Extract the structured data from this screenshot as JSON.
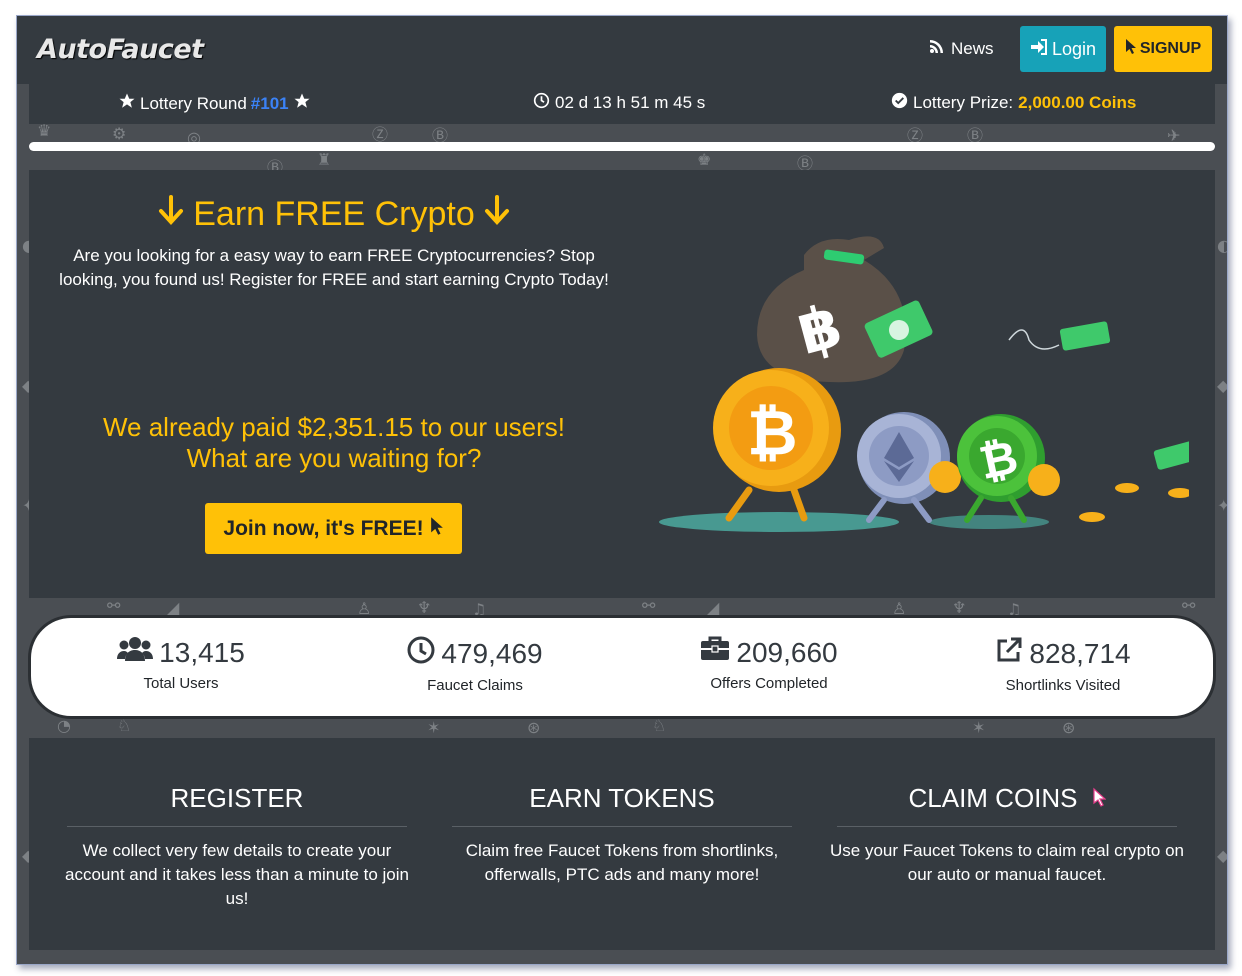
{
  "navbar": {
    "brand": "AutoFaucet",
    "news_label": "News",
    "login_label": "Login",
    "signup_label": "SIGNUP"
  },
  "lottery": {
    "round_label": "Lottery Round",
    "round_number": "#101",
    "countdown": "02 d 13 h 51 m 45 s",
    "prize_label": "Lottery Prize:",
    "prize_amount": "2,000.00 Coins"
  },
  "hero": {
    "title": "Earn FREE Crypto",
    "description": "Are you looking for a easy way to earn FREE Cryptocurrencies? Stop looking, you found us! Register for FREE and start earning Crypto Today!",
    "paid_line1": "We already paid $2,351.15 to our users!",
    "paid_line2": "What are you waiting for?",
    "join_label": "Join now, it's FREE!"
  },
  "stats": [
    {
      "icon": "users-icon",
      "value": "13,415",
      "label": "Total Users"
    },
    {
      "icon": "clock-icon",
      "value": "479,469",
      "label": "Faucet Claims"
    },
    {
      "icon": "briefcase-icon",
      "value": "209,660",
      "label": "Offers Completed"
    },
    {
      "icon": "external-link-icon",
      "value": "828,714",
      "label": "Shortlinks Visited"
    }
  ],
  "steps": [
    {
      "title": "REGISTER",
      "description": "We collect very few details to create your account and it takes less than a minute to join us!"
    },
    {
      "title": "EARN TOKENS",
      "description": "Claim free Faucet Tokens from shortlinks, offerwalls, PTC ads and many more!"
    },
    {
      "title": "CLAIM COINS",
      "description": "Use your Faucet Tokens to claim real crypto on our auto or manual faucet."
    }
  ],
  "colors": {
    "accent_yellow": "#ffc107",
    "login_teal": "#17a2b8",
    "panel_dark": "#343a40",
    "round_blue": "#3b82f6"
  }
}
